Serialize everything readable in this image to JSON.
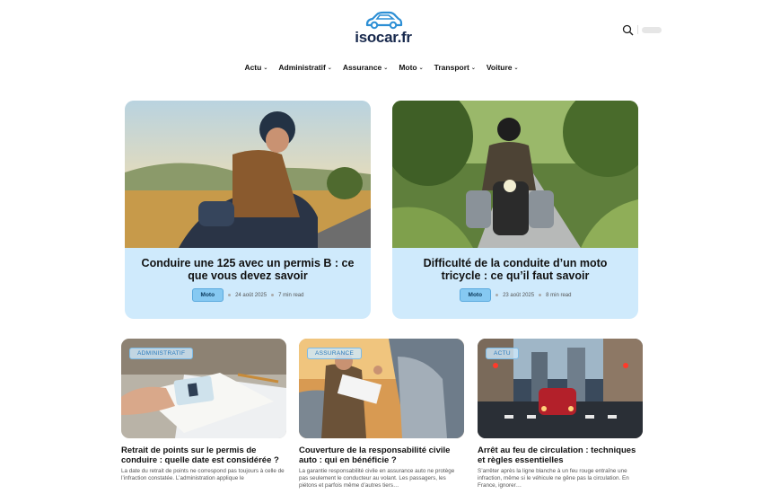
{
  "site": {
    "logo_text": "isocar.fr"
  },
  "nav": [
    {
      "label": "Actu"
    },
    {
      "label": "Administratif"
    },
    {
      "label": "Assurance"
    },
    {
      "label": "Moto"
    },
    {
      "label": "Transport"
    },
    {
      "label": "Voiture"
    }
  ],
  "featured": [
    {
      "title": "Conduire une 125 avec un permis B : ce que vous devez savoir",
      "tag": "Moto",
      "date": "24 août 2025",
      "read_time": "7 min read"
    },
    {
      "title": "Difficulté de la conduite d’un moto tricycle : ce qu’il faut savoir",
      "tag": "Moto",
      "date": "23 août 2025",
      "read_time": "8 min read"
    }
  ],
  "cards": [
    {
      "badge": "ADMINISTRATIF",
      "title": "Retrait de points sur le permis de conduire : quelle date est considérée ?",
      "excerpt": "La date du retrait de points ne correspond pas toujours à celle de l’infraction constatée. L’administration applique le"
    },
    {
      "badge": "ASSURANCE",
      "title": "Couverture de la responsabilité civile auto : qui en bénéficie ?",
      "excerpt": "La garantie responsabilité civile en assurance auto ne protège pas seulement le conducteur au volant. Les passagers, les piétons et parfois même d’autres tiers…"
    },
    {
      "badge": "ACTU",
      "title": "Arrêt au feu de circulation : techniques et règles essentielles",
      "excerpt": "S’arrêter après la ligne blanche à un feu rouge entraîne une infraction, même si le véhicule ne gêne pas la circulation. En France, ignorer…"
    }
  ],
  "colors": {
    "accent": "#2d8fd5",
    "card_bg": "#cfeafc",
    "tag_bg": "#86c9f2",
    "logo_text": "#18294d"
  }
}
